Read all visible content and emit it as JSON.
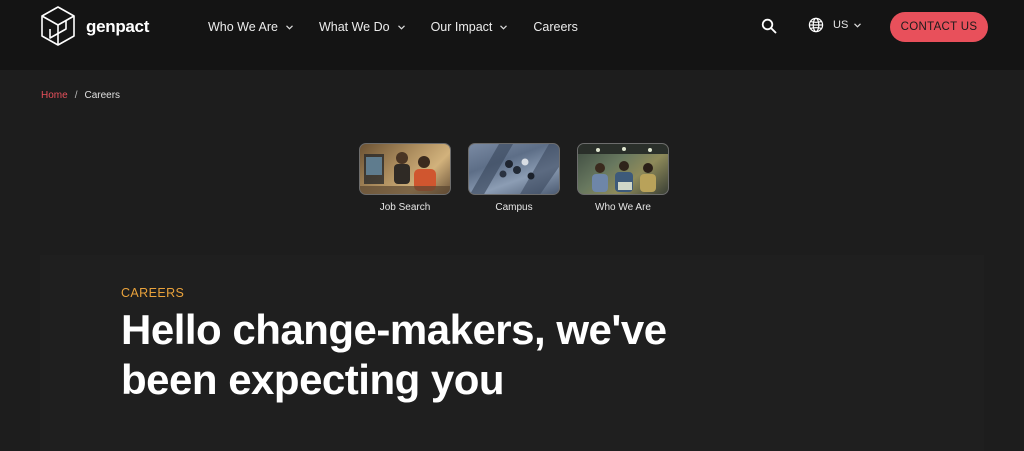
{
  "header": {
    "logo_text": "genpact",
    "nav": [
      {
        "label": "Who We Are",
        "has_dropdown": true
      },
      {
        "label": "What We Do",
        "has_dropdown": true
      },
      {
        "label": "Our Impact",
        "has_dropdown": true
      },
      {
        "label": "Careers",
        "has_dropdown": false
      }
    ],
    "search_icon": "search-icon",
    "locale": {
      "icon": "globe-icon",
      "label": "US"
    },
    "contact_label": "CONTACT US"
  },
  "breadcrumb": {
    "home": "Home",
    "separator": "/",
    "current": "Careers"
  },
  "quick_links": [
    {
      "label": "Job Search"
    },
    {
      "label": "Campus"
    },
    {
      "label": "Who We Are"
    }
  ],
  "hero": {
    "eyebrow": "CAREERS",
    "headline": "Hello change-makers, we've been expecting you"
  },
  "colors": {
    "accent": "#e8505b",
    "eyebrow": "#e9a23b",
    "header_bg": "#141414",
    "page_bg": "#1d1d1d"
  }
}
